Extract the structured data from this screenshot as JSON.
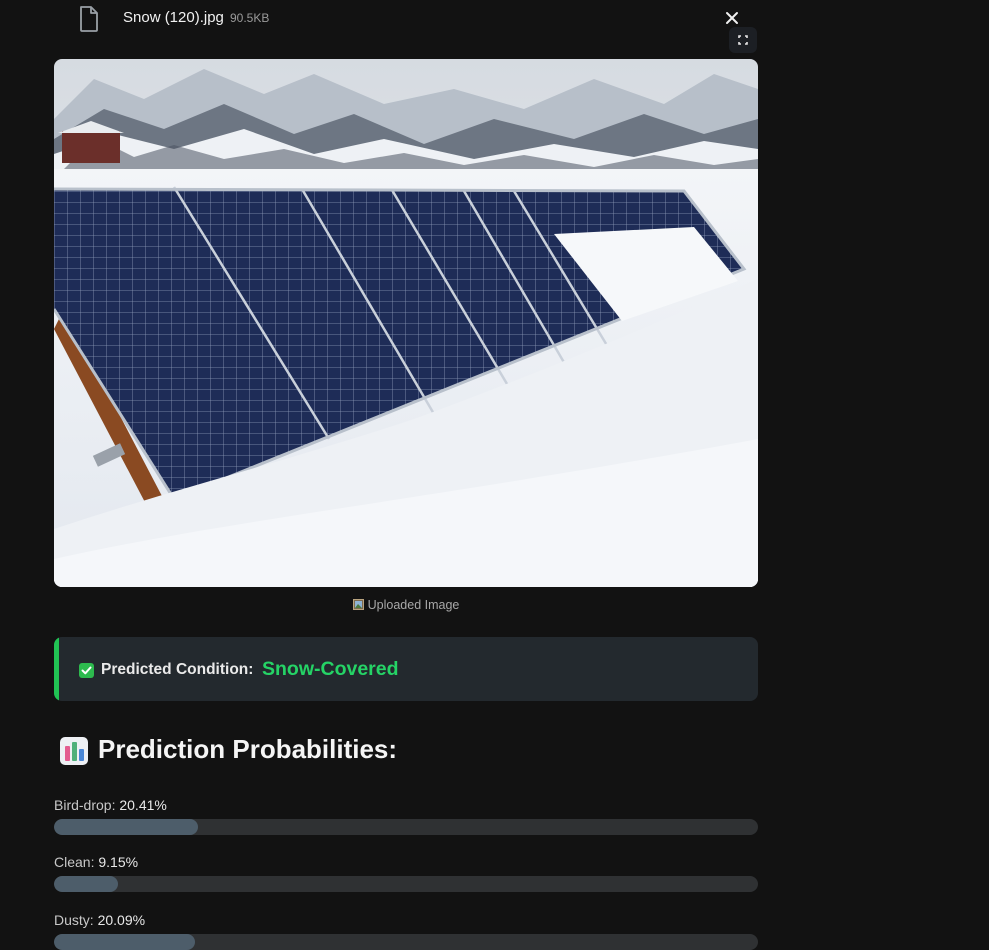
{
  "file": {
    "name": "Snow (120).jpg",
    "size": "90.5KB",
    "icons": {
      "file": "file-icon",
      "close": "close-icon",
      "fullscreen": "fullscreen-icon"
    }
  },
  "image": {
    "caption": "Uploaded Image",
    "caption_icon": "framed-picture-icon",
    "description_colors": {
      "snow": "#f4f6f8",
      "panel": "#1f2f5c",
      "sky": "#dfe3e8"
    }
  },
  "prediction": {
    "label": "Predicted Condition:",
    "value": "Snow-Covered",
    "icon": "check-mark-icon",
    "accent": "#21c354"
  },
  "probabilities": {
    "heading": "Prediction Probabilities:",
    "heading_icon": "bar-chart-icon",
    "items": [
      {
        "name": "Bird-drop:",
        "value_text": "20.41%",
        "value": 0.2041
      },
      {
        "name": "Clean:",
        "value_text": "9.15%",
        "value": 0.0915
      },
      {
        "name": "Dusty:",
        "value_text": "20.09%",
        "value": 0.2009
      }
    ]
  }
}
